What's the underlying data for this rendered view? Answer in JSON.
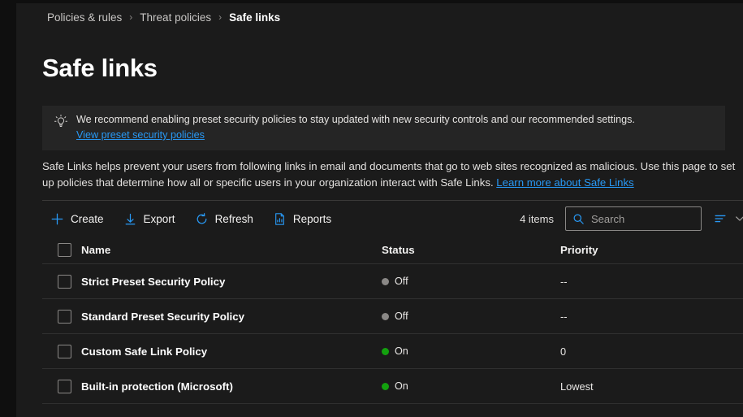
{
  "colors": {
    "accent": "#2899f5",
    "status_on": "#13a10e",
    "status_off": "#8a8886",
    "page_bg": "#1b1b1b",
    "banner_bg": "#252525"
  },
  "breadcrumb": {
    "items": [
      {
        "label": "Policies & rules",
        "current": false
      },
      {
        "label": "Threat policies",
        "current": false
      },
      {
        "label": "Safe links",
        "current": true
      }
    ],
    "separator": "›"
  },
  "page": {
    "title": "Safe links"
  },
  "banner": {
    "icon": "lightbulb-icon",
    "text": "We recommend enabling preset security policies to stay updated with new security controls and our recommended settings.",
    "link_label": "View preset security policies"
  },
  "description": {
    "text": "Safe Links helps prevent your users from following links in email and documents that go to web sites recognized as malicious. Use this page to set up policies that determine how all or specific users in your organization interact with Safe Links. ",
    "link_label": "Learn more about Safe Links"
  },
  "toolbar": {
    "buttons": [
      {
        "label": "Create",
        "icon": "plus-icon"
      },
      {
        "label": "Export",
        "icon": "download-arrow-icon"
      },
      {
        "label": "Refresh",
        "icon": "refresh-icon"
      },
      {
        "label": "Reports",
        "icon": "report-chart-icon"
      }
    ],
    "item_count": "4 items",
    "search": {
      "placeholder": "Search",
      "value": "",
      "icon": "search-icon"
    },
    "filter_icon": "filter-lines-icon",
    "chevron_icon": "chevron-down-icon"
  },
  "table": {
    "columns": [
      {
        "key": "name",
        "label": "Name"
      },
      {
        "key": "status",
        "label": "Status"
      },
      {
        "key": "priority",
        "label": "Priority"
      }
    ],
    "rows": [
      {
        "name": "Strict Preset Security Policy",
        "status": "Off",
        "status_state": "off",
        "priority": "--"
      },
      {
        "name": "Standard Preset Security Policy",
        "status": "Off",
        "status_state": "off",
        "priority": "--"
      },
      {
        "name": "Custom Safe Link Policy",
        "status": "On",
        "status_state": "on",
        "priority": "0"
      },
      {
        "name": "Built-in protection (Microsoft)",
        "status": "On",
        "status_state": "on",
        "priority": "Lowest"
      }
    ]
  }
}
